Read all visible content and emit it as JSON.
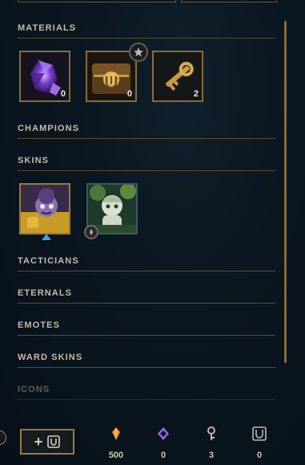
{
  "sections": {
    "materials": {
      "title": "MATERIALS",
      "items": [
        {
          "name": "crystal-shard",
          "count": "0"
        },
        {
          "name": "chest",
          "count": "0"
        },
        {
          "name": "key",
          "count": "2"
        }
      ]
    },
    "champions": {
      "title": "CHAMPIONS"
    },
    "skins": {
      "title": "SKINS"
    },
    "tacticians": {
      "title": "TACTICIANS"
    },
    "eternals": {
      "title": "ETERNALS"
    },
    "emotes": {
      "title": "EMOTES"
    },
    "ward_skins": {
      "title": "WARD SKINS"
    },
    "icons": {
      "title": "ICONS"
    }
  },
  "bottom": {
    "craft_label": "+",
    "currencies": [
      {
        "icon": "blue-essence-icon",
        "value": "500"
      },
      {
        "icon": "orange-essence-icon",
        "value": "0"
      },
      {
        "icon": "key-fragment-icon",
        "value": "3"
      },
      {
        "icon": "chest-icon",
        "value": "0"
      }
    ]
  },
  "colors": {
    "background": "#0a1620",
    "accent_gold": "#8a6d35",
    "text": "#c4bca8",
    "blue_essence": "#e98d2c",
    "orange_essence": "#9c6ae0"
  }
}
